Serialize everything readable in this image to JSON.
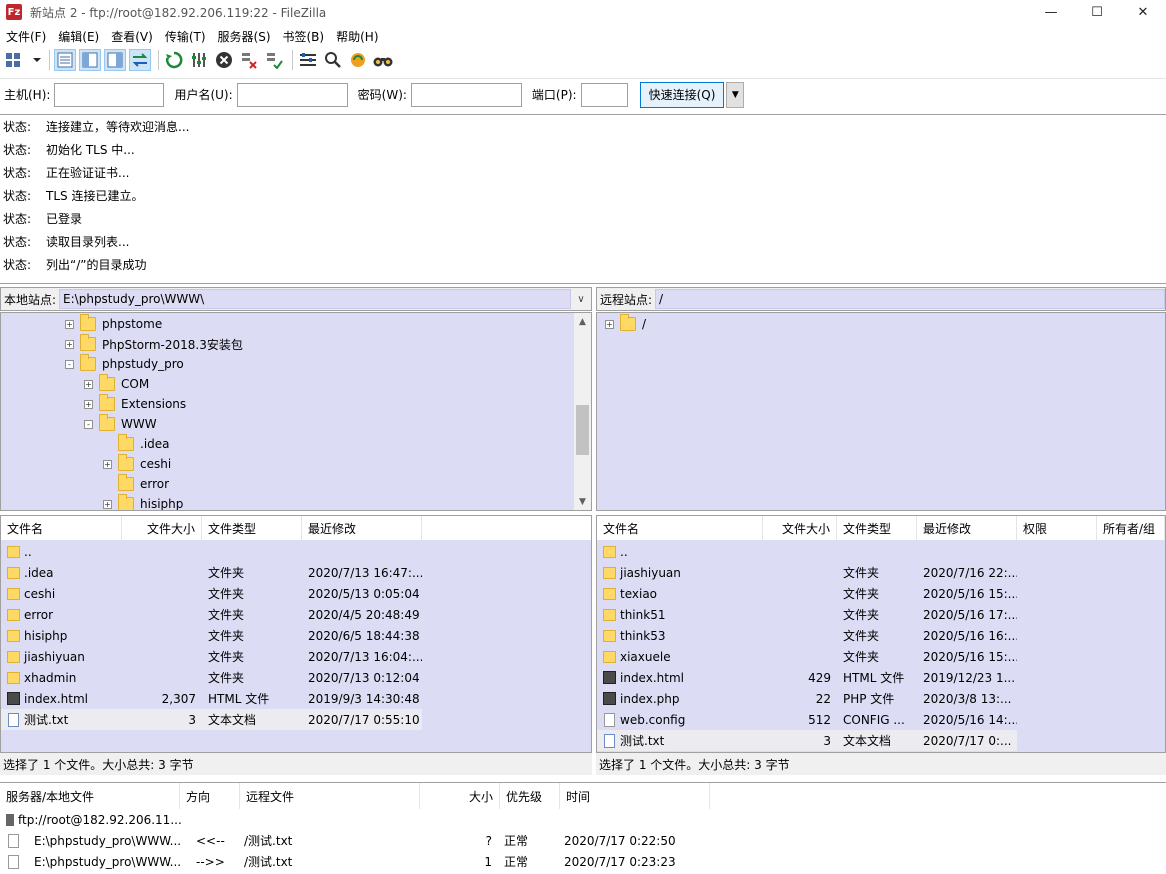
{
  "window": {
    "title": "新站点 2 - ftp://root@182.92.206.119:22 - FileZilla",
    "app_icon": "Fz"
  },
  "menu": [
    "文件(F)",
    "编辑(E)",
    "查看(V)",
    "传输(T)",
    "服务器(S)",
    "书签(B)",
    "帮助(H)"
  ],
  "quickconnect": {
    "host_label": "主机(H):",
    "host_value": "",
    "user_label": "用户名(U):",
    "user_value": "",
    "pass_label": "密码(W):",
    "pass_value": "",
    "port_label": "端口(P):",
    "port_value": "",
    "connect_label": "快速连接(Q)"
  },
  "log": [
    {
      "type": "状态:",
      "text": "连接建立，等待欢迎消息..."
    },
    {
      "type": "状态:",
      "text": "初始化 TLS 中..."
    },
    {
      "type": "状态:",
      "text": "正在验证证书..."
    },
    {
      "type": "状态:",
      "text": "TLS 连接已建立。"
    },
    {
      "type": "状态:",
      "text": "已登录"
    },
    {
      "type": "状态:",
      "text": "读取目录列表..."
    },
    {
      "type": "状态:",
      "text": "列出“/”的目录成功"
    }
  ],
  "local": {
    "label": "本地站点:",
    "path": "E:\\phpstudy_pro\\WWW\\",
    "tree": [
      {
        "name": "phpstome",
        "exp": "+"
      },
      {
        "name": "PhpStorm-2018.3安装包",
        "exp": "+"
      },
      {
        "name": "phpstudy_pro",
        "exp": "-"
      },
      {
        "name": "COM",
        "exp": "+"
      },
      {
        "name": "Extensions",
        "exp": "+"
      },
      {
        "name": "WWW",
        "exp": "-"
      },
      {
        "name": ".idea",
        "exp": ""
      },
      {
        "name": "ceshi",
        "exp": "+"
      },
      {
        "name": "error",
        "exp": ""
      },
      {
        "name": "hisiphp",
        "exp": "+"
      }
    ],
    "headers": [
      "文件名",
      "文件大小",
      "文件类型",
      "最近修改"
    ],
    "files": [
      {
        "name": "..",
        "size": "",
        "type": "",
        "modified": ""
      },
      {
        "name": ".idea",
        "size": "",
        "type": "文件夹",
        "modified": "2020/7/13 16:47:..."
      },
      {
        "name": "ceshi",
        "size": "",
        "type": "文件夹",
        "modified": "2020/5/13 0:05:04"
      },
      {
        "name": "error",
        "size": "",
        "type": "文件夹",
        "modified": "2020/4/5 20:48:49"
      },
      {
        "name": "hisiphp",
        "size": "",
        "type": "文件夹",
        "modified": "2020/6/5 18:44:38"
      },
      {
        "name": "jiashiyuan",
        "size": "",
        "type": "文件夹",
        "modified": "2020/7/13 16:04:..."
      },
      {
        "name": "xhadmin",
        "size": "",
        "type": "文件夹",
        "modified": "2020/7/13 0:12:04"
      },
      {
        "name": "index.html",
        "size": "2,307",
        "type": "HTML 文件",
        "modified": "2019/9/3 14:30:48"
      },
      {
        "name": "测试.txt",
        "size": "3",
        "type": "文本文档",
        "modified": "2020/7/17 0:55:10"
      }
    ],
    "status": "选择了 1 个文件。大小总共: 3 字节"
  },
  "remote": {
    "label": "远程站点:",
    "path": "/",
    "tree": [
      {
        "name": "/",
        "exp": "+"
      }
    ],
    "headers": [
      "文件名",
      "文件大小",
      "文件类型",
      "最近修改",
      "权限",
      "所有者/组"
    ],
    "files": [
      {
        "name": "..",
        "size": "",
        "type": "",
        "modified": ""
      },
      {
        "name": "jiashiyuan",
        "size": "",
        "type": "文件夹",
        "modified": "2020/7/16 22:..."
      },
      {
        "name": "texiao",
        "size": "",
        "type": "文件夹",
        "modified": "2020/5/16 15:..."
      },
      {
        "name": "think51",
        "size": "",
        "type": "文件夹",
        "modified": "2020/5/16 17:..."
      },
      {
        "name": "think53",
        "size": "",
        "type": "文件夹",
        "modified": "2020/5/16 16:..."
      },
      {
        "name": "xiaxuele",
        "size": "",
        "type": "文件夹",
        "modified": "2020/5/16 15:..."
      },
      {
        "name": "index.html",
        "size": "429",
        "type": "HTML 文件",
        "modified": "2019/12/23 1..."
      },
      {
        "name": "index.php",
        "size": "22",
        "type": "PHP 文件",
        "modified": "2020/3/8 13:..."
      },
      {
        "name": "web.config",
        "size": "512",
        "type": "CONFIG ...",
        "modified": "2020/5/16 14:..."
      },
      {
        "name": "测试.txt",
        "size": "3",
        "type": "文本文档",
        "modified": "2020/7/17 0:..."
      }
    ],
    "status": "选择了 1 个文件。大小总共: 3 字节"
  },
  "queue": {
    "headers": [
      "服务器/本地文件",
      "方向",
      "远程文件",
      "大小",
      "优先级",
      "时间"
    ],
    "server": "ftp://root@182.92.206.11...",
    "rows": [
      {
        "local": "E:\\phpstudy_pro\\WWW...",
        "dir": "<<--",
        "remote": "/测试.txt",
        "size": "?",
        "priority": "正常",
        "time": "2020/7/17 0:22:50"
      },
      {
        "local": "E:\\phpstudy_pro\\WWW...",
        "dir": "-->>",
        "remote": "/测试.txt",
        "size": "1",
        "priority": "正常",
        "time": "2020/7/17 0:23:23"
      }
    ]
  }
}
